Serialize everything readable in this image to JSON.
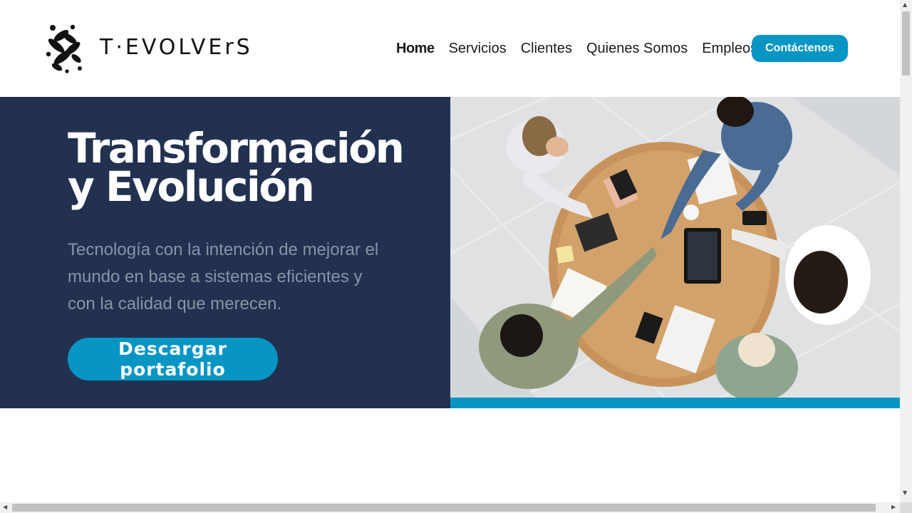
{
  "header": {
    "logo_text": "T·EVOLVErS",
    "nav": [
      {
        "label": "Home",
        "active": true
      },
      {
        "label": "Servicios",
        "active": false
      },
      {
        "label": "Clientes",
        "active": false
      },
      {
        "label": "Quienes Somos",
        "active": false
      },
      {
        "label": "Empleos",
        "active": false
      }
    ],
    "contact_label": "Contáctenos"
  },
  "hero": {
    "title_line1": "Transformación",
    "title_line2": "y Evolución",
    "description": "Tecnología con la intención de mejorar el mundo en base a sistemas eficientes y con la calidad que merecen.",
    "download_label": "Descargar portafolio"
  },
  "colors": {
    "accent": "#0795c4",
    "hero_bg": "#223150",
    "hero_text_muted": "#8a93a6"
  },
  "icons": {
    "logo_mark": "t-evolvers-logo-icon",
    "scroll_up": "chevron-up-icon",
    "scroll_down": "chevron-down-icon",
    "scroll_left": "chevron-left-icon",
    "scroll_right": "chevron-right-icon"
  }
}
